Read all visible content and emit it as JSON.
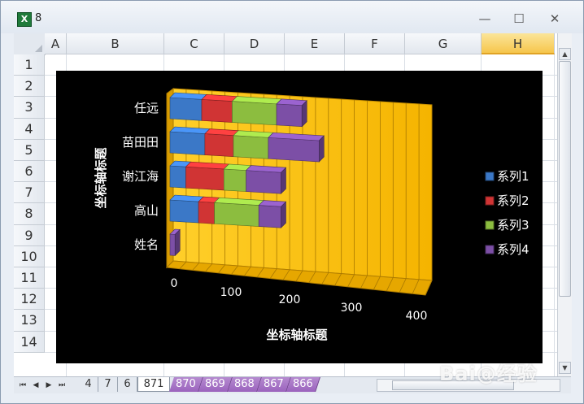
{
  "window": {
    "title": "8",
    "minimize": "—",
    "maximize": "☐",
    "close": "✕"
  },
  "columns": [
    "A",
    "B",
    "C",
    "D",
    "E",
    "F",
    "G",
    "H"
  ],
  "rows": [
    "1",
    "2",
    "3",
    "4",
    "5",
    "6",
    "7",
    "8",
    "9",
    "10",
    "11",
    "12",
    "13",
    "14"
  ],
  "selected_column": "H",
  "sheet_tabs": {
    "plain": [
      "4",
      "7",
      "6"
    ],
    "active": "871",
    "purple": [
      "870",
      "869",
      "868",
      "867",
      "866"
    ]
  },
  "chart_data": {
    "type": "bar",
    "orientation": "horizontal",
    "stacked": true,
    "three_d": true,
    "categories": [
      "姓名",
      "高山",
      "谢江海",
      "苗田田",
      "任远"
    ],
    "series": [
      {
        "name": "系列1",
        "color": "#3b78c7",
        "values": [
          0,
          45,
          25,
          55,
          50
        ]
      },
      {
        "name": "系列2",
        "color": "#d03434",
        "values": [
          0,
          25,
          60,
          45,
          48
        ]
      },
      {
        "name": "系列3",
        "color": "#8cbd3f",
        "values": [
          0,
          70,
          35,
          55,
          70
        ]
      },
      {
        "name": "系列4",
        "color": "#7c4fa6",
        "values": [
          8,
          35,
          55,
          80,
          40
        ]
      }
    ],
    "x_ticks": [
      "0",
      "100",
      "200",
      "300",
      "400"
    ],
    "xlim": [
      0,
      400
    ],
    "xlabel": "坐标轴标题",
    "ylabel": "坐标轴标题",
    "legend_position": "right",
    "wall_color": "#ffc000",
    "background": "#000000"
  }
}
